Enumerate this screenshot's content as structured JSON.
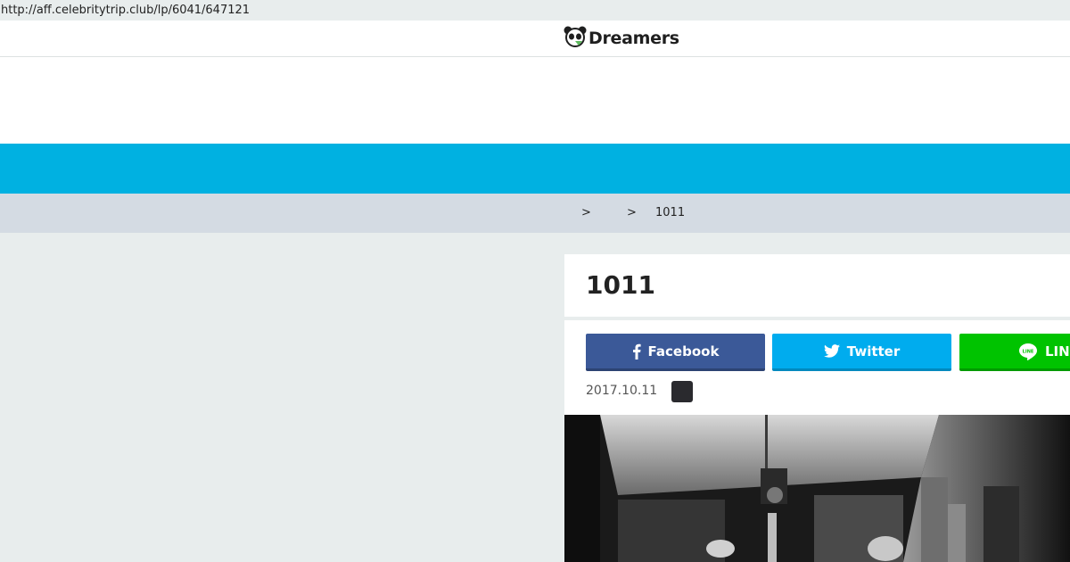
{
  "browser": {
    "url": "http://aff.celebritytrip.club/lp/6041/647121"
  },
  "header": {
    "logo_text": "Dreamers",
    "logo_icon": "panda-icon"
  },
  "breadcrumb": {
    "separator_1": ">",
    "separator_2": ">",
    "current": "1011"
  },
  "article": {
    "title": "1011",
    "date": "2017.10.11",
    "share": {
      "facebook_label": "Facebook",
      "twitter_label": "Twitter",
      "line_label": "LINE"
    }
  },
  "colors": {
    "nav_band": "#00b1e1",
    "facebook": "#3b5998",
    "twitter": "#00acee",
    "line": "#00c300",
    "breadcrumb_bg": "#d4dbe3",
    "page_bg": "#e8eded"
  }
}
